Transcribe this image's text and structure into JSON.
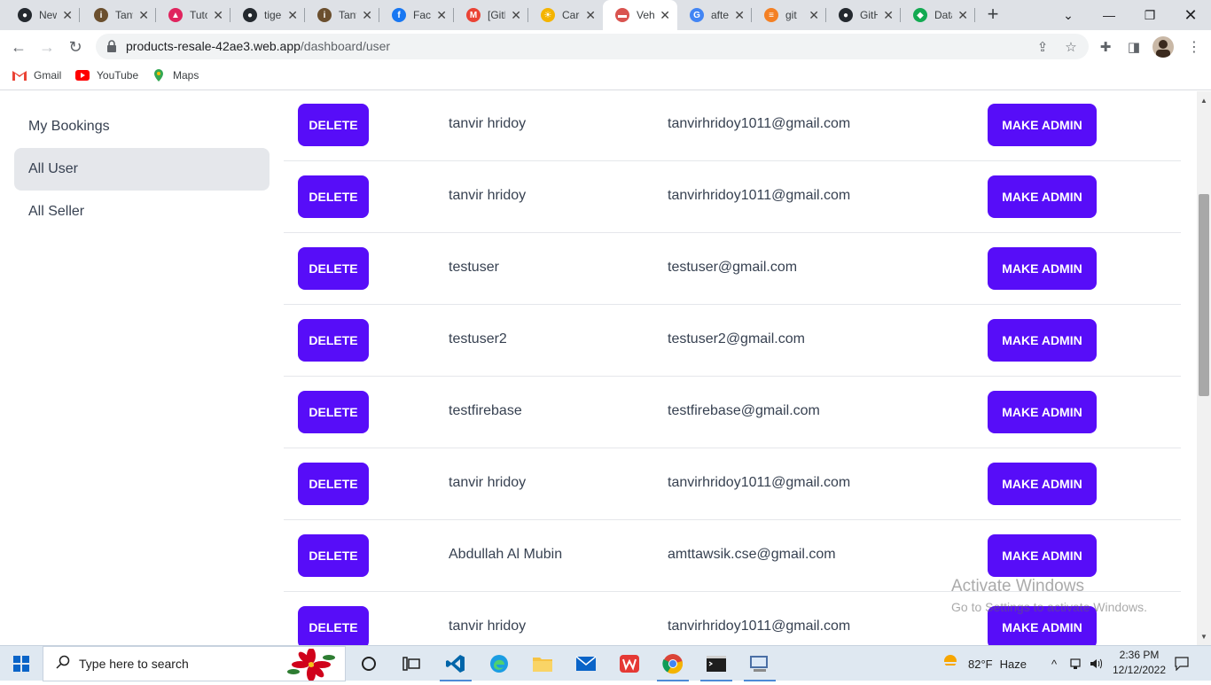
{
  "browser": {
    "tabs": [
      {
        "title": "New",
        "favicon": "github-icon",
        "color": "#24292f",
        "glyph": "●"
      },
      {
        "title": "Tanvir",
        "favicon": "person-icon",
        "color": "#6b4f2e",
        "glyph": "i"
      },
      {
        "title": "Tutorial",
        "favicon": "tutorial-icon",
        "color": "#e0245e",
        "glyph": "▲"
      },
      {
        "title": "tiger",
        "favicon": "github-icon",
        "color": "#24292f",
        "glyph": "●"
      },
      {
        "title": "Tanvir",
        "favicon": "person-icon",
        "color": "#6b4f2e",
        "glyph": "i"
      },
      {
        "title": "Facebook",
        "favicon": "facebook-icon",
        "color": "#1877f2",
        "glyph": "f"
      },
      {
        "title": "[GitHub]",
        "favicon": "gmail-icon",
        "color": "#ea4335",
        "glyph": "M"
      },
      {
        "title": "Care",
        "favicon": "sun-icon",
        "color": "#f4b400",
        "glyph": "☀"
      },
      {
        "title": "Vehicle",
        "favicon": "car-icon",
        "color": "#d9534f",
        "glyph": "▬"
      },
      {
        "title": "after",
        "favicon": "google-icon",
        "color": "#4285f4",
        "glyph": "G"
      },
      {
        "title": "git",
        "favicon": "stackoverflow-icon",
        "color": "#f48024",
        "glyph": "≡"
      },
      {
        "title": "GitHub",
        "favicon": "github-icon",
        "color": "#24292f",
        "glyph": "●"
      },
      {
        "title": "Data",
        "favicon": "mongodb-icon",
        "color": "#13aa52",
        "glyph": "◆"
      }
    ],
    "url_host": "products-resale-42ae3.web.app",
    "url_path": "/dashboard/user",
    "bookmarks": [
      {
        "label": "Gmail",
        "icon": "gmail-icon"
      },
      {
        "label": "YouTube",
        "icon": "youtube-icon"
      },
      {
        "label": "Maps",
        "icon": "maps-icon"
      }
    ]
  },
  "sidebar": {
    "items": [
      {
        "label": "My Bookings",
        "active": false
      },
      {
        "label": "All User",
        "active": true
      },
      {
        "label": "All Seller",
        "active": false
      }
    ]
  },
  "users": {
    "delete_label": "DELETE",
    "make_admin_label": "MAKE ADMIN",
    "rows": [
      {
        "name": "tanvir hridoy",
        "email": "tanvirhridoy1011@gmail.com"
      },
      {
        "name": "tanvir hridoy",
        "email": "tanvirhridoy1011@gmail.com"
      },
      {
        "name": "testuser",
        "email": "testuser@gmail.com"
      },
      {
        "name": "testuser2",
        "email": "testuser2@gmail.com"
      },
      {
        "name": "testfirebase",
        "email": "testfirebase@gmail.com"
      },
      {
        "name": "tanvir hridoy",
        "email": "tanvirhridoy1011@gmail.com"
      },
      {
        "name": "Abdullah Al Mubin",
        "email": "amttawsik.cse@gmail.com"
      },
      {
        "name": "tanvir hridoy",
        "email": "tanvirhridoy1011@gmail.com"
      }
    ]
  },
  "watermark": {
    "line1": "Activate Windows",
    "line2": "Go to Settings to activate Windows."
  },
  "taskbar": {
    "search_placeholder": "Type here to search",
    "weather_temp": "82°F",
    "weather_text": "Haze",
    "time": "2:36 PM",
    "date": "12/12/2022"
  },
  "theme": {
    "primary": "#570df8",
    "sidebar_active_bg": "#e5e7eb"
  }
}
